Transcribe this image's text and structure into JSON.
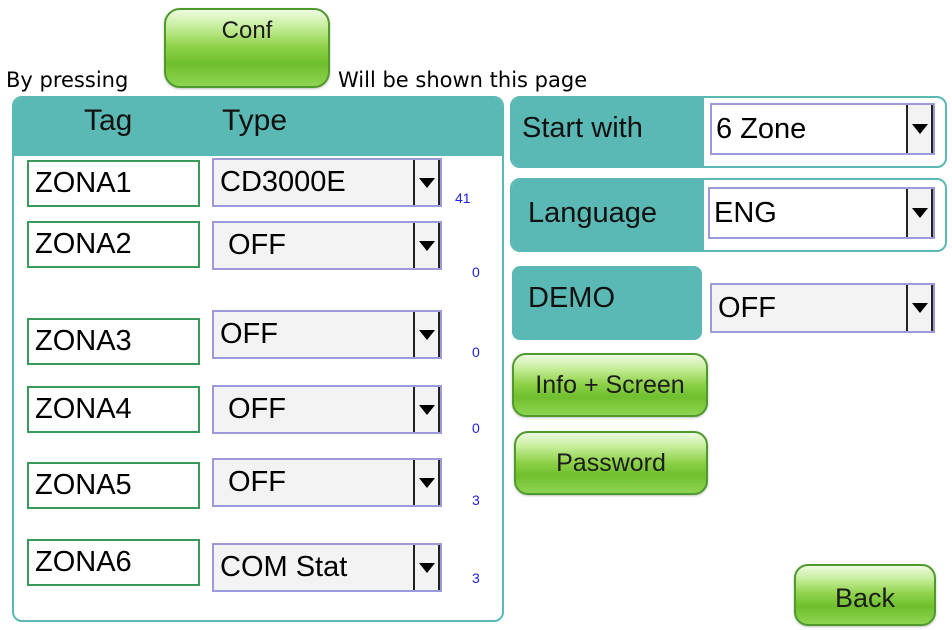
{
  "intro": {
    "before": "By pressing",
    "after": "Will be shown this page",
    "conf_button_label": "Conf"
  },
  "zones_panel": {
    "header_tag": "Tag",
    "header_type": "Type",
    "rows": [
      {
        "tag": "ZONA1",
        "type": "CD3000E",
        "count": "41"
      },
      {
        "tag": "ZONA2",
        "type": " OFF",
        "count": "0"
      },
      {
        "tag": "ZONA3",
        "type": "OFF",
        "count": "0"
      },
      {
        "tag": "ZONA4",
        "type": " OFF",
        "count": "0"
      },
      {
        "tag": "ZONA5",
        "type": " OFF",
        "count": "3"
      },
      {
        "tag": "ZONA6",
        "type": "COM Stat",
        "count": "3"
      }
    ]
  },
  "settings": {
    "start_with": {
      "label": "Start with",
      "value": "6 Zone"
    },
    "language": {
      "label": "Language",
      "value": "ENG"
    },
    "demo": {
      "label": "DEMO",
      "value": "OFF"
    }
  },
  "buttons": {
    "info_screen": "Info + Screen",
    "password": "Password",
    "back": "Back"
  },
  "colors": {
    "panel_teal": "#5ab9b4",
    "button_green": "#7cc83a",
    "count_blue": "#2020e0"
  }
}
